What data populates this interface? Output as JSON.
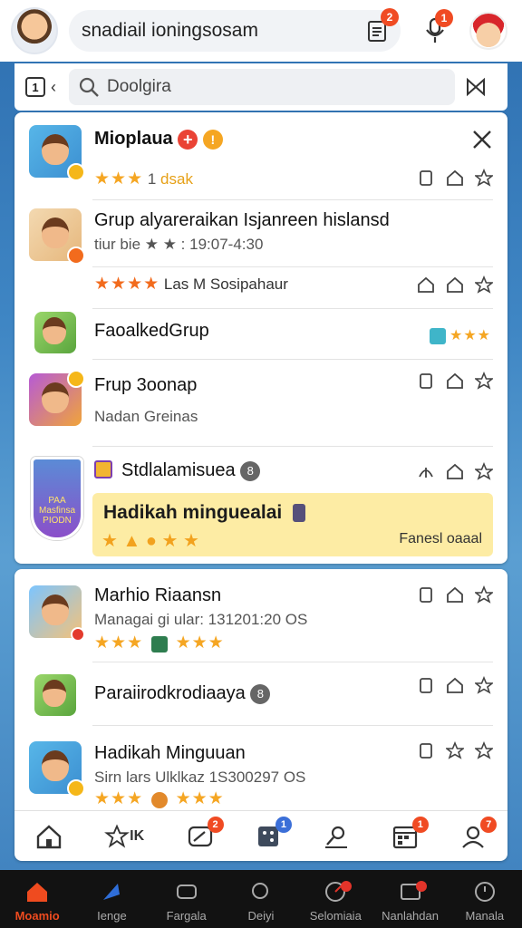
{
  "header": {
    "search_text": "snadiail ioningsosam",
    "doc_badge": "2",
    "mic_badge": "1"
  },
  "subbar": {
    "search_placeholder": "Doolgira"
  },
  "card1": {
    "rows": [
      {
        "title": "Mioplaua",
        "sub_left": "1",
        "sub_tag": "dsak",
        "stars": "★★★"
      },
      {
        "title": "Grup  alyareraikan Isjanreen hislansd",
        "sub": "tiur   bie ★ ★ : 19:07-4:30",
        "stars_line": "★★★★",
        "stars_text": "Las M Sosipahaur"
      },
      {
        "title": "FaoalkedGrup",
        "right_stars": "★★★"
      },
      {
        "title": "Frup 3oonap",
        "sub": "Nadan Greinas"
      },
      {
        "title": "Stdlalamisuea",
        "badge": "8"
      }
    ],
    "highlight": {
      "title": "Hadikah minguealai",
      "stars": "★ ▲ ● ★ ★",
      "right": "Fanesl oaaal"
    },
    "shield_text": "PAA\nMasfinsa\nPIODN"
  },
  "card2": {
    "rows": [
      {
        "title": "Marhio Riaansn",
        "sub": "Managai gi ular: 131201:20 OS",
        "stars": "★★★",
        "stars2": "★★★"
      },
      {
        "title": "Paraiirodkrodiaaya",
        "badge": "8"
      },
      {
        "title": "Hadikah Minguuan",
        "sub": "Sirn  lars Ulklkaz 1S300297 OS",
        "stars": "★★★",
        "stars2": "★★★"
      }
    ],
    "tool_badges": [
      "2",
      "1",
      "1",
      "7"
    ],
    "tool_star_label": "IK"
  },
  "bottom_nav": [
    {
      "label": "Moamio",
      "active": true
    },
    {
      "label": "Ienge",
      "active": false
    },
    {
      "label": "Fargala",
      "active": false
    },
    {
      "label": "Deiyi",
      "active": false
    },
    {
      "label": "Selomiaia",
      "active": false
    },
    {
      "label": "Nanlahdan",
      "active": false
    },
    {
      "label": "Manala",
      "active": false
    }
  ],
  "colors": {
    "accent": "#ef4b1f",
    "star": "#f5a623",
    "highlight": "#fdeca4"
  }
}
